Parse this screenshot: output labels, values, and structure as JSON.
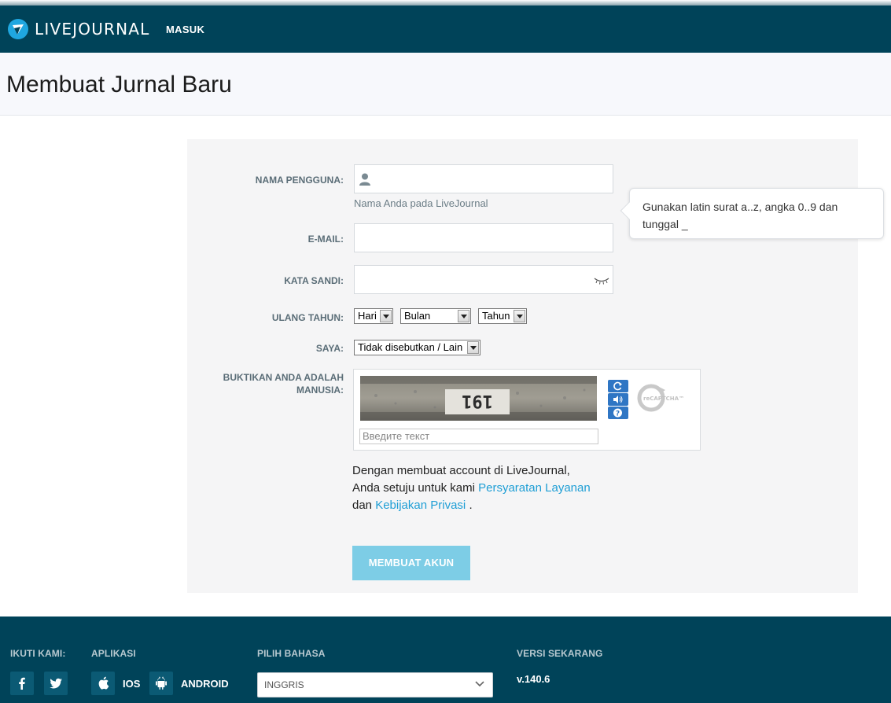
{
  "header": {
    "logo_text": "LIVEJOURNAL",
    "login_label": "MASUK"
  },
  "page": {
    "title": "Membuat Jurnal Baru"
  },
  "form": {
    "username_label": "NAMA PENGGUNA:",
    "username_value": "",
    "username_hint": "Nama Anda pada LiveJournal",
    "username_tooltip": "Gunakan latin surat a..z, angka 0..9 dan tunggal _",
    "email_label": "E-MAIL:",
    "email_value": "",
    "password_label": "KATA SANDI:",
    "password_value": "",
    "birthday_label": "ULANG TAHUN:",
    "birthday_day": "Hari",
    "birthday_month": "Bulan",
    "birthday_year": "Tahun",
    "gender_label": "SAYA:",
    "gender_value": "Tidak disebutkan / Lain",
    "captcha_label_line1": "BUKTIKAN ANDA ADALAH",
    "captcha_label_line2": "MANUSIA:",
    "captcha_image_text": "191",
    "captcha_placeholder": "Введите текст",
    "recaptcha_brand": "reCAPTCHA™",
    "terms_prefix": "Dengan membuat account di LiveJournal,",
    "terms_line2": "Anda setuju untuk kami",
    "terms_link": "Persyaratan Layanan",
    "terms_and": "dan",
    "privacy_link": "Kebijakan Privasi",
    "terms_end": ".",
    "submit_label": "MEMBUAT AKUN"
  },
  "footer": {
    "follow_label": "IKUTI KAMI:",
    "apps_label": "APLIKASI",
    "ios_label": "IOS",
    "android_label": "ANDROID",
    "language_label": "PILIH BAHASA",
    "language_value": "INGGRIS",
    "version_label": "VERSI SEKARANG",
    "version_value": "v.140.6"
  },
  "colors": {
    "header_bg": "#004359",
    "accent": "#1e9ed5",
    "submit_bg": "#7dcde6"
  }
}
